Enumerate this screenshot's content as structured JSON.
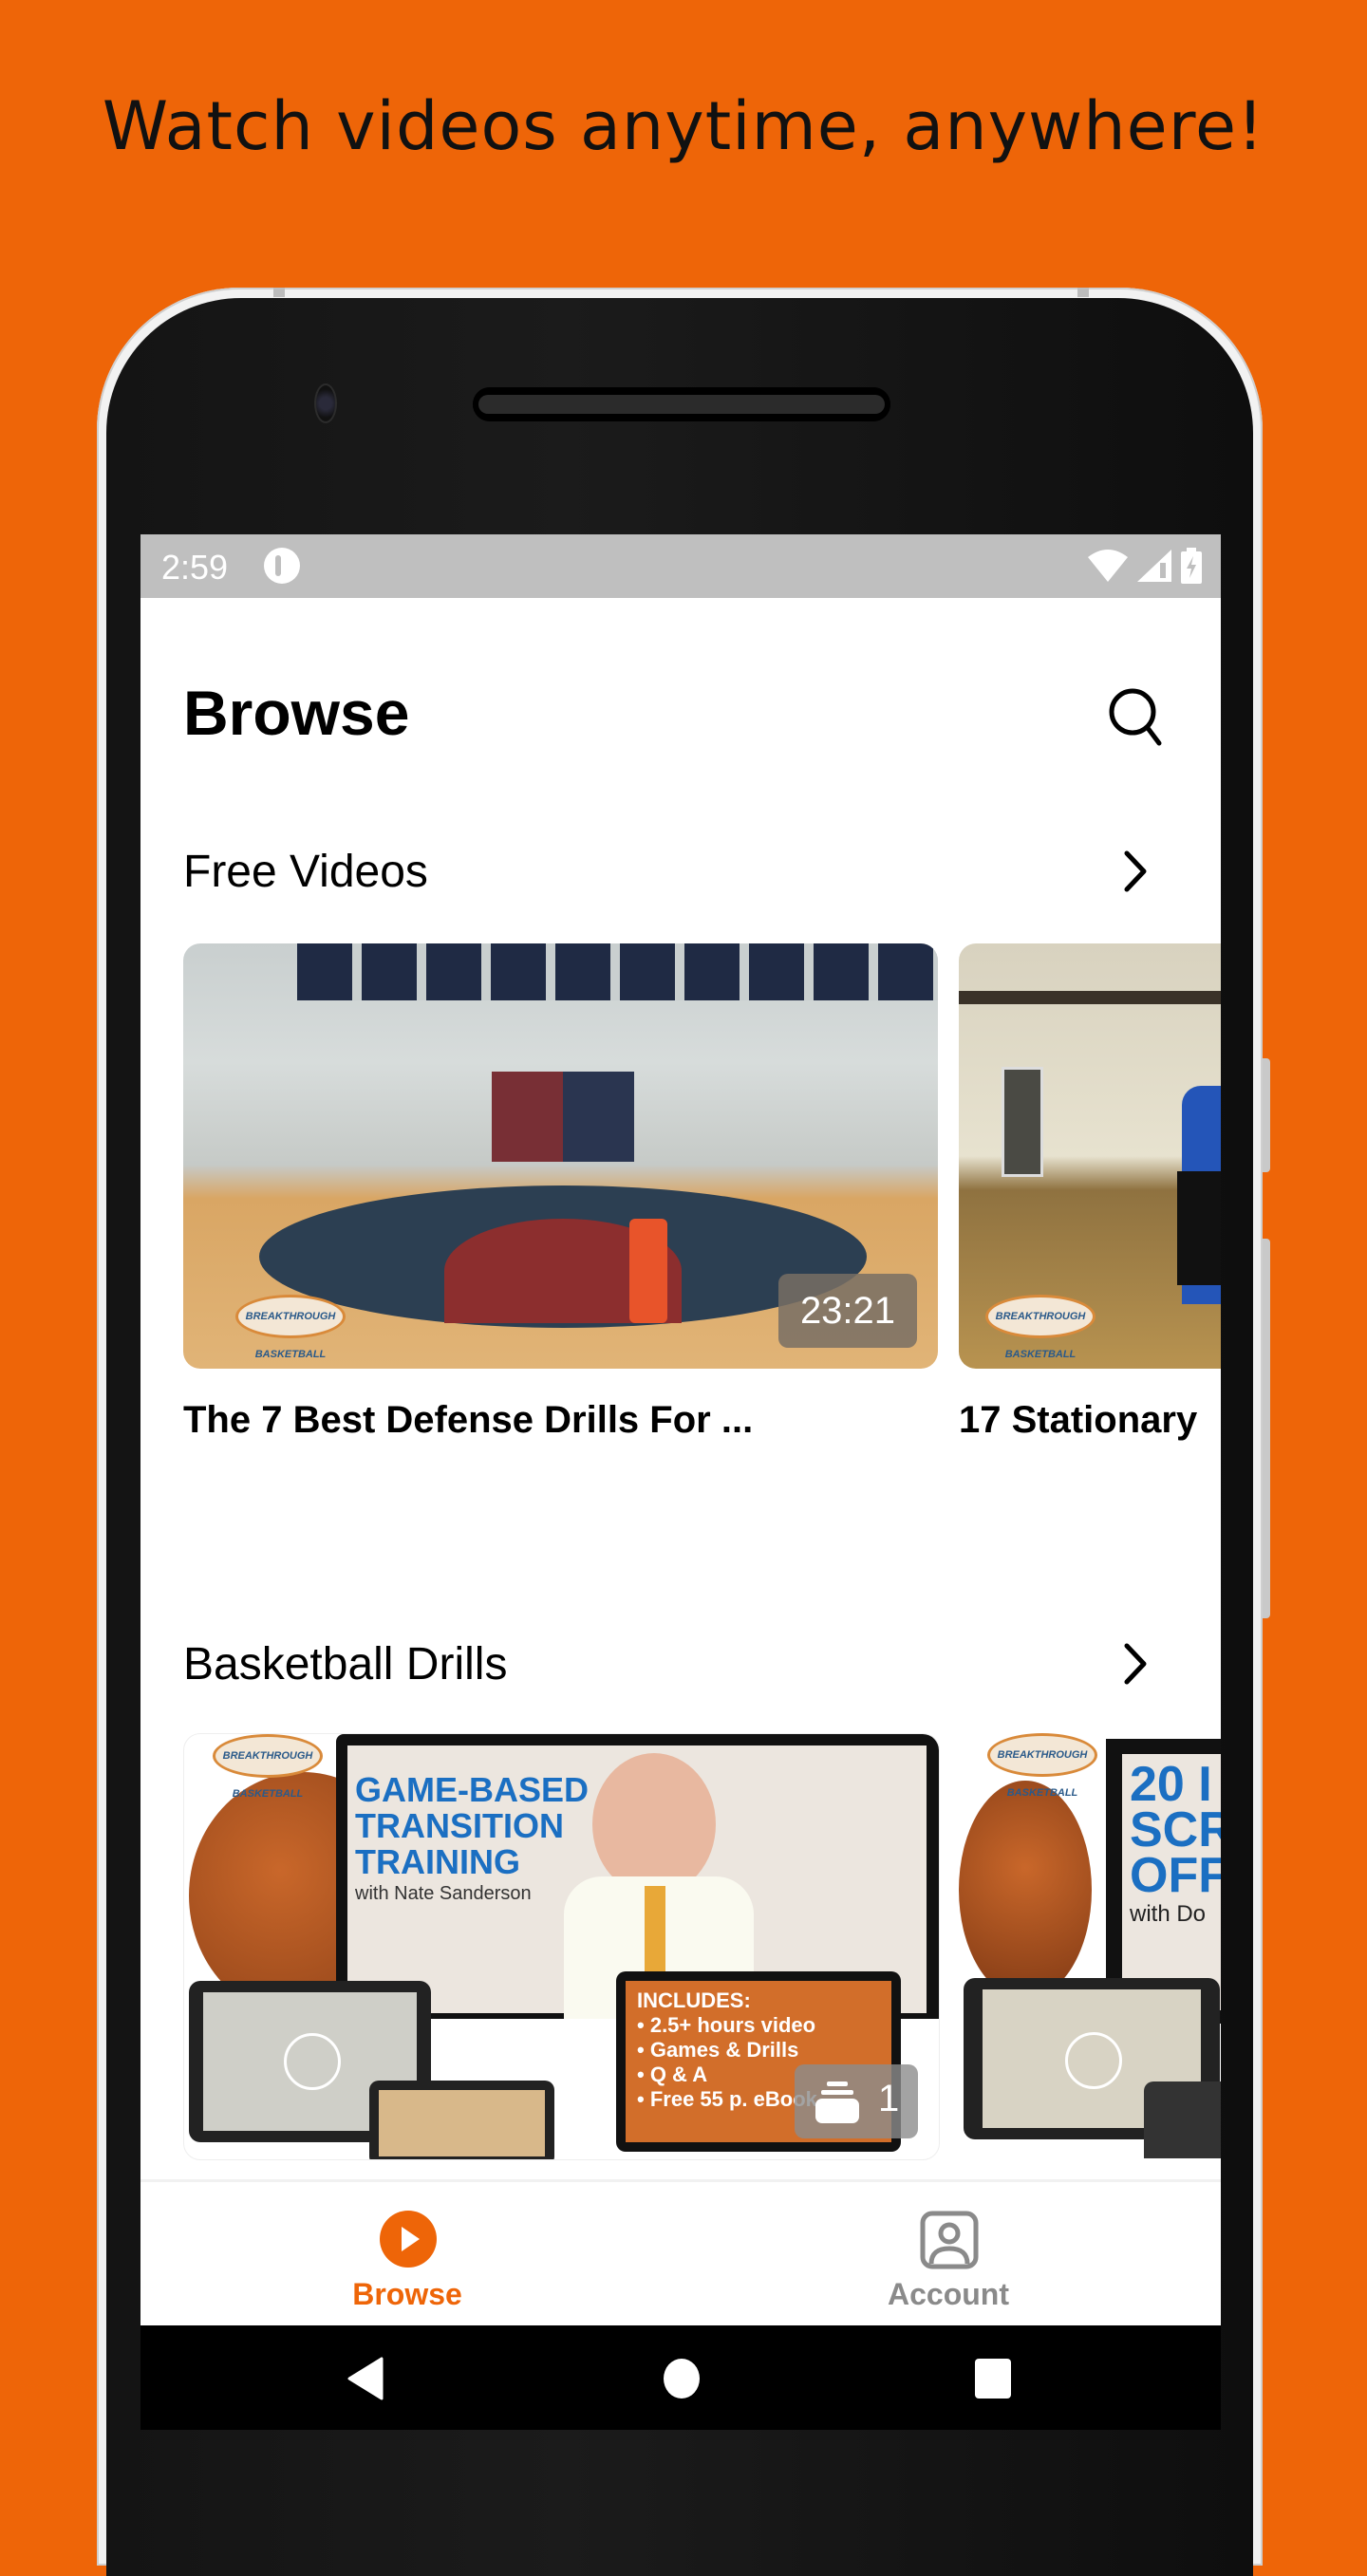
{
  "promo": {
    "headline": "Watch videos anytime, anywhere!"
  },
  "colors": {
    "background": "#EE6508",
    "accent": "#EE6508",
    "inactive_tab": "#8A8A8A",
    "status_bar": "#BFBFBF"
  },
  "status_bar": {
    "time": "2:59",
    "icons": [
      "app-notification-icon",
      "wifi-icon",
      "cell-signal-icon",
      "battery-charging-icon"
    ]
  },
  "header": {
    "title": "Browse",
    "search_icon": "search-icon"
  },
  "sections": [
    {
      "title": "Free Videos",
      "items": [
        {
          "title": "The 7 Best Defense Drills For ...",
          "duration": "23:21",
          "watermark": "BREAKTHROUGH BASKETBALL"
        },
        {
          "title": "17 Stationary",
          "watermark": "BREAKTHROUGH BASKETBALL"
        }
      ]
    },
    {
      "title": "Basketball Drills",
      "items": [
        {
          "watermark": "BREAKTHROUGH BASKETBALL",
          "poster_title": [
            "GAME-BASED",
            "TRANSITION",
            "TRAINING"
          ],
          "poster_subtitle": "with Nate Sanderson",
          "includes_heading": "INCLUDES:",
          "includes": [
            "2.5+ hours video",
            "Games & Drills",
            "Q & A",
            "Free 55 p. eBook"
          ],
          "count": "1"
        },
        {
          "watermark": "BREAKTHROUGH BASKETBALL",
          "poster_title": [
            "20 I",
            "SCR",
            "OFF"
          ],
          "poster_subtitle": "with Do"
        }
      ]
    }
  ],
  "tabs": [
    {
      "label": "Browse",
      "icon": "play-circle-icon",
      "active": true
    },
    {
      "label": "Account",
      "icon": "account-icon",
      "active": false
    }
  ],
  "nav": {
    "back": "back-icon",
    "home": "home-icon",
    "recents": "recents-icon"
  }
}
